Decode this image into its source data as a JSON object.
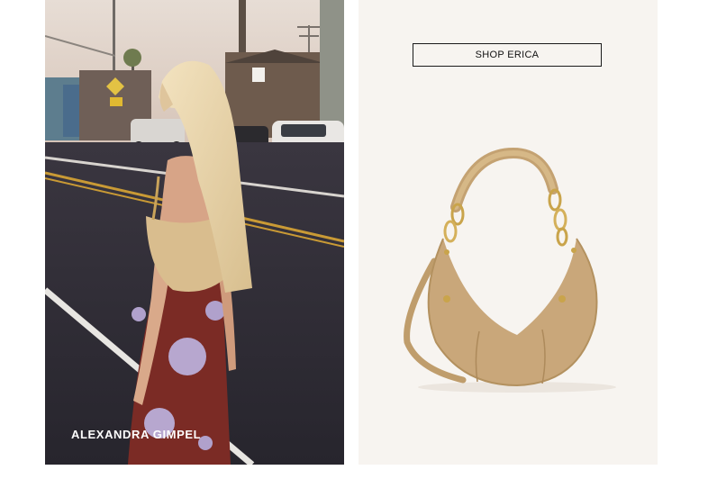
{
  "editorial": {
    "caption": "ALEXANDRA GIMPEL"
  },
  "product": {
    "shop_label": "SHOP ERICA"
  },
  "colors": {
    "panel_background": "#f7f4f0",
    "bag_tan": "#c9a77a",
    "caption_text": "#ffffff"
  }
}
